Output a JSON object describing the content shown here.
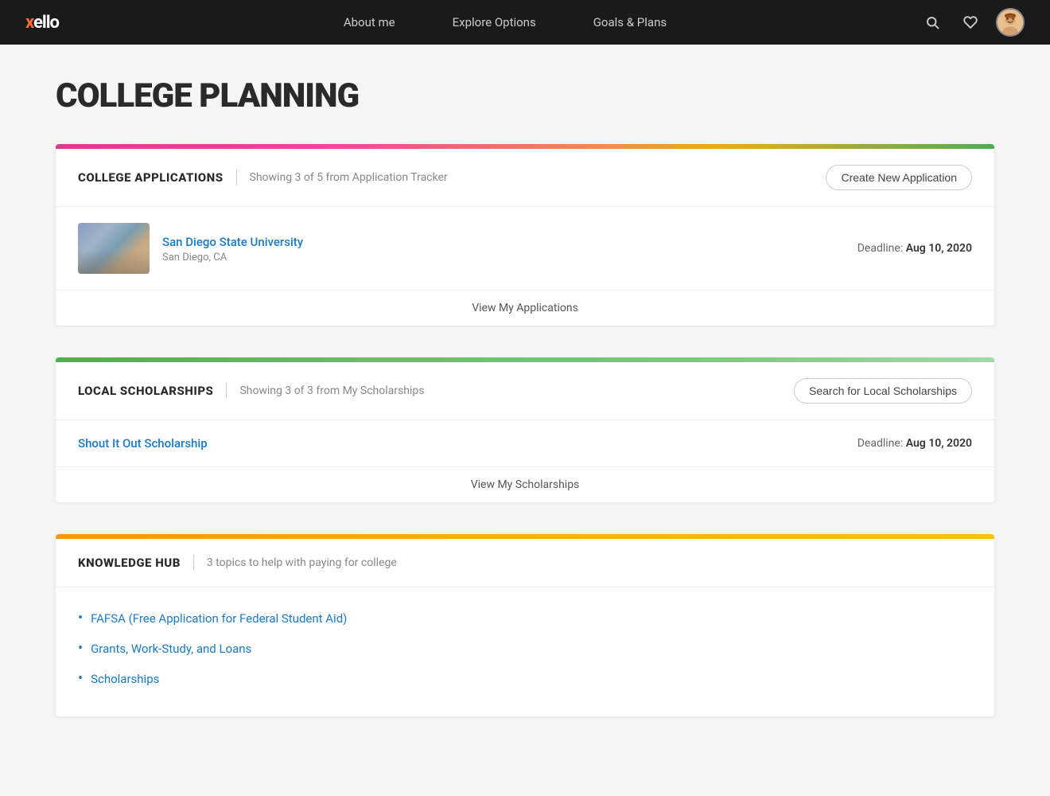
{
  "nav": {
    "logo": "xello",
    "links": [
      {
        "label": "About me",
        "id": "about-me"
      },
      {
        "label": "Explore Options",
        "id": "explore-options"
      },
      {
        "label": "Goals & Plans",
        "id": "goals-plans"
      }
    ],
    "search_icon": "🔍",
    "heart_icon": "♡",
    "avatar_icon": "🧑"
  },
  "page": {
    "title": "COLLEGE PLANNING"
  },
  "college_applications": {
    "section_title": "COLLEGE APPLICATIONS",
    "subtitle": "Showing 3 of 5 from Application Tracker",
    "action_label": "Create New Application",
    "applications": [
      {
        "name": "San Diego State University",
        "location": "San Diego, CA",
        "deadline_label": "Deadline:",
        "deadline_value": "Aug 10, 2020"
      }
    ],
    "view_more_label": "View My Applications"
  },
  "local_scholarships": {
    "section_title": "LOCAL SCHOLARSHIPS",
    "subtitle": "Showing 3 of 3 from My Scholarships",
    "action_label": "Search for Local Scholarships",
    "scholarships": [
      {
        "name": "Shout It Out Scholarship",
        "deadline_label": "Deadline:",
        "deadline_value": "Aug 10, 2020"
      }
    ],
    "view_more_label": "View My Scholarships"
  },
  "knowledge_hub": {
    "section_title": "KNOWLEDGE HUB",
    "subtitle": "3 topics to help with paying for college",
    "topics": [
      {
        "label": "FAFSA (Free Application for Federal Student Aid)"
      },
      {
        "label": "Grants, Work-Study, and Loans"
      },
      {
        "label": "Scholarships"
      }
    ]
  }
}
